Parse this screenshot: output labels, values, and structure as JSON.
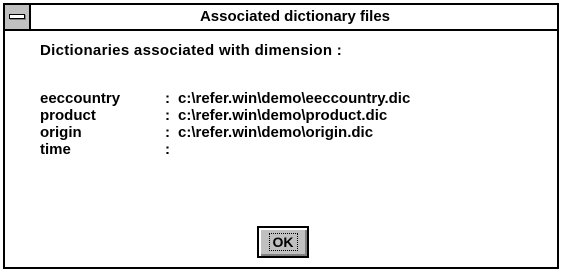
{
  "window": {
    "title": "Associated dictionary files"
  },
  "heading": "Dictionaries associated with dimension :",
  "dictionaries": [
    {
      "name": "eeccountry",
      "separator": ":",
      "path": "c:\\refer.win\\demo\\eeccountry.dic"
    },
    {
      "name": "product",
      "separator": ":",
      "path": "c:\\refer.win\\demo\\product.dic"
    },
    {
      "name": "origin",
      "separator": ":",
      "path": "c:\\refer.win\\demo\\origin.dic"
    },
    {
      "name": "time",
      "separator": ":",
      "path": ""
    }
  ],
  "buttons": {
    "ok_label": "OK"
  },
  "colors": {
    "window_background": "#ffffff",
    "border": "#000000",
    "button_face": "#c0c0c0"
  },
  "icons": {
    "system_menu": "system-menu-icon"
  }
}
